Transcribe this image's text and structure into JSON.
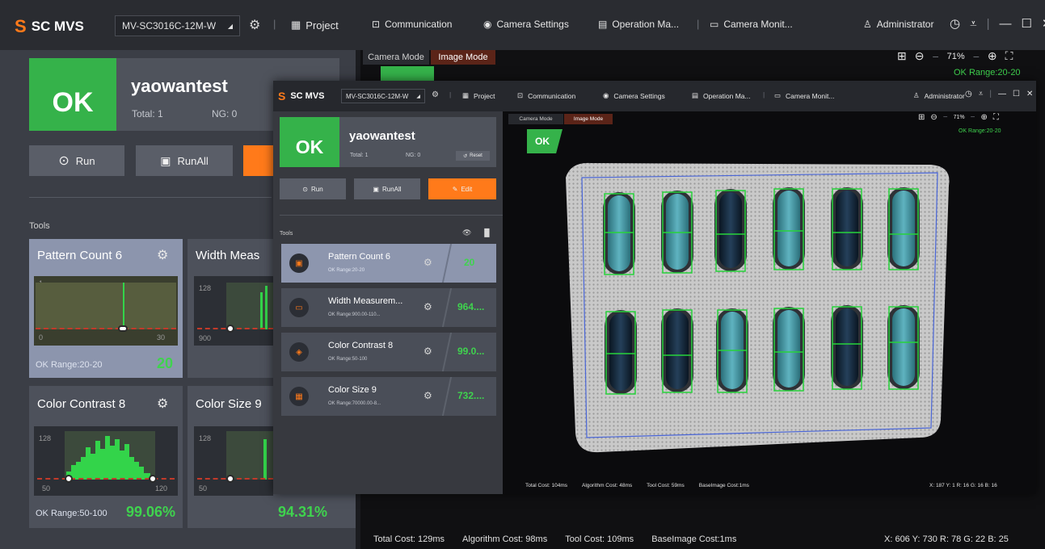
{
  "app": {
    "logo_text": "SC MVS",
    "device": "MV-SC3016C-12M-W",
    "menu": {
      "project": "Project",
      "communication": "Communication",
      "camera_settings": "Camera Settings",
      "operation": "Operation Ma...",
      "camera_monitor": "Camera Monit..."
    },
    "user": "Administrator",
    "colors": {
      "accent": "#ff7a1a",
      "ok": "#35b24a",
      "value_green": "#3fd34e",
      "active_tab": "#5b2418"
    }
  },
  "main_panel": {
    "status": "OK",
    "job_name": "yaowantest",
    "total": "Total: 1",
    "ng": "NG: 0",
    "buttons": {
      "run": "Run",
      "run_all": "RunAll"
    },
    "tools_label": "Tools",
    "tools": [
      {
        "name": "Pattern Count 6",
        "hist_top": "1",
        "hist_min": "0",
        "hist_max": "30",
        "range": "OK Range:20-20",
        "value": "20"
      },
      {
        "name": "Width Meas",
        "hist_top": "128",
        "hist_min": "900"
      },
      {
        "name": "Color Contrast 8",
        "hist_top": "128",
        "hist_min": "50",
        "hist_max": "120",
        "range": "OK Range:50-100",
        "value": "99.06%"
      },
      {
        "name": "Color Size 9",
        "hist_top": "128",
        "hist_min": "50",
        "value": "94.31%"
      }
    ]
  },
  "viewer_big": {
    "tabs": {
      "camera": "Camera Mode",
      "image": "Image Mode"
    },
    "zoom": "71%",
    "ok_range": "OK Range:20-20",
    "footer": {
      "total_cost": "Total Cost: 129ms",
      "algorithm_cost": "Algorithm Cost: 98ms",
      "tool_cost": "Tool Cost: 109ms",
      "base_cost": "BaseImage Cost:1ms",
      "pixel": "X: 606 Y: 730  R: 78 G: 22 B: 25"
    }
  },
  "small_window": {
    "status": "OK",
    "job_name": "yaowantest",
    "total": "Total: 1",
    "ng": "NG: 0",
    "reset": "Reset",
    "buttons": {
      "run": "Run",
      "run_all": "RunAll",
      "edit": "Edit"
    },
    "tools_label": "Tools",
    "tools": [
      {
        "name": "Pattern Count 6",
        "range": "OK Range:20-20",
        "value": "20",
        "icon": "pattern-icon"
      },
      {
        "name": "Width Measurem...",
        "range": "OK Range:900.00-110...",
        "value": "964....",
        "icon": "width-icon"
      },
      {
        "name": "Color Contrast 8",
        "range": "OK Range:50-100",
        "value": "99.0...",
        "icon": "contrast-icon"
      },
      {
        "name": "Color Size 9",
        "range": "OK Range:70000.00-8...",
        "value": "732....",
        "icon": "size-icon"
      }
    ],
    "viewer": {
      "tabs": {
        "camera": "Camera Mode",
        "image": "Image Mode"
      },
      "zoom": "71%",
      "ok_badge": "OK",
      "ok_range": "OK Range:20-20",
      "footer": {
        "total_cost": "Total Cost: 104ms",
        "algorithm_cost": "Algorithm Cost: 48ms",
        "tool_cost": "Tool Cost: 59ms",
        "base_cost": "BaseImage Cost:1ms",
        "pixel": "X: 187 Y: 1  R: 16 G: 16 B: 16"
      }
    }
  }
}
